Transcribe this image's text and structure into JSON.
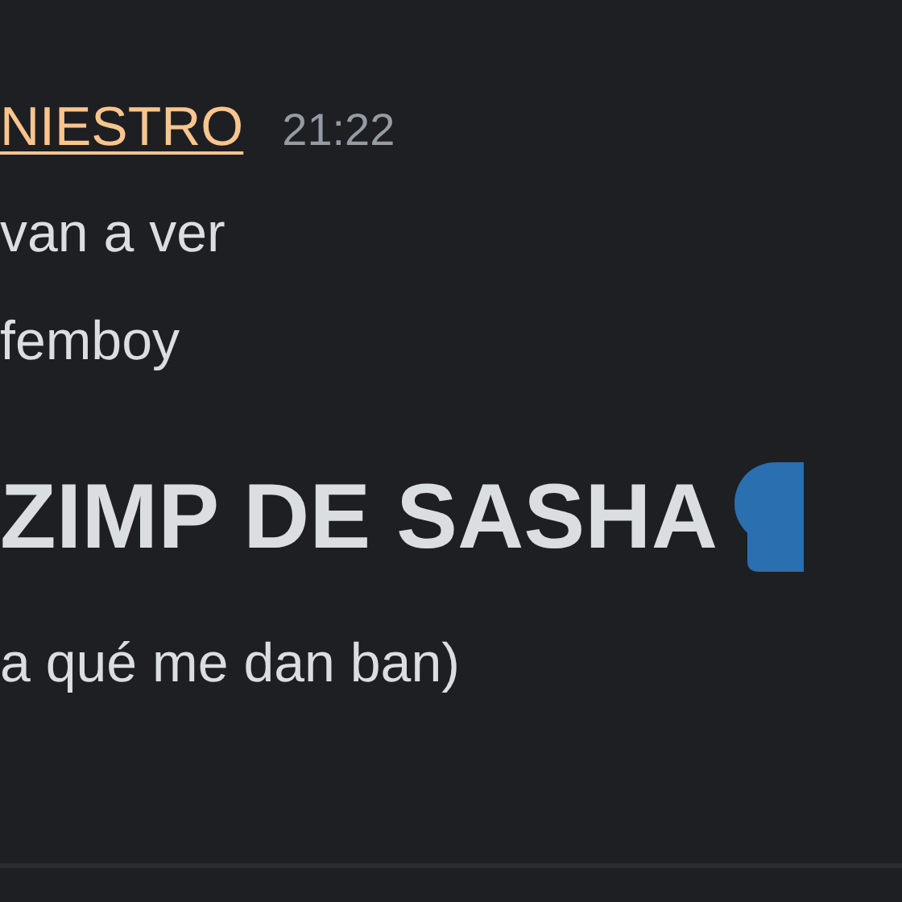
{
  "message": {
    "author": "NIESTRO",
    "time": "21:22",
    "lines": [
      {
        "kind": "text",
        "text": "van a ver"
      },
      {
        "kind": "text",
        "text": "femboy"
      },
      {
        "kind": "header",
        "text": "ZIMP DE SASHA"
      },
      {
        "kind": "text",
        "text": "a qué me dan ban)"
      }
    ]
  }
}
